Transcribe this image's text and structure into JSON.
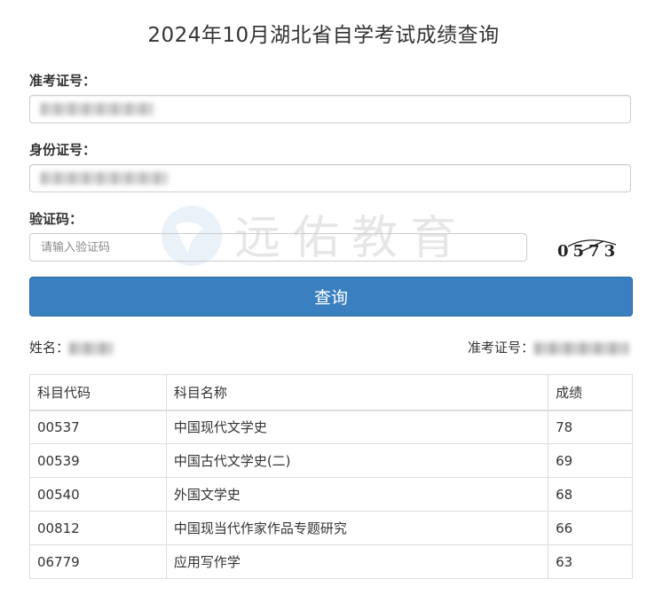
{
  "page": {
    "title": "2024年10月湖北省自学考试成绩查询"
  },
  "form": {
    "exam_id_label": "准考证号：",
    "id_card_label": "身份证号：",
    "captcha_label": "验证码：",
    "captcha_placeholder": "请输入验证码",
    "captcha_code": "0573",
    "submit_label": "查询"
  },
  "watermark": {
    "text": "远佑教育"
  },
  "result_info": {
    "name_label": "姓名：",
    "exam_id_label": "准考证号："
  },
  "table": {
    "headers": [
      "科目代码",
      "科目名称",
      "成绩"
    ],
    "rows": [
      {
        "code": "00537",
        "name": "中国现代文学史",
        "score": "78"
      },
      {
        "code": "00539",
        "name": "中国古代文学史(二)",
        "score": "69"
      },
      {
        "code": "00540",
        "name": "外国文学史",
        "score": "68"
      },
      {
        "code": "00812",
        "name": "中国现当代作家作品专题研究",
        "score": "66"
      },
      {
        "code": "06779",
        "name": "应用写作学",
        "score": "63"
      }
    ]
  },
  "colors": {
    "primary_button": "#3a7fbf",
    "border": "#cccccc",
    "table_border": "#dddddd",
    "text": "#333333"
  }
}
